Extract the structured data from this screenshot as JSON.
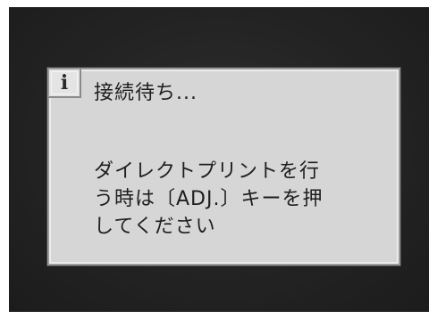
{
  "dialog": {
    "icon": "info-icon",
    "icon_glyph": "i",
    "title": "接続待ち...",
    "message_lines": [
      "ダイレクトプリントを行",
      "う時は〔ADJ.〕キーを押",
      "してください"
    ]
  },
  "colors": {
    "screen_bg": "#262626",
    "dialog_bg": "#d6d6d6",
    "text": "#1e1e1e"
  }
}
